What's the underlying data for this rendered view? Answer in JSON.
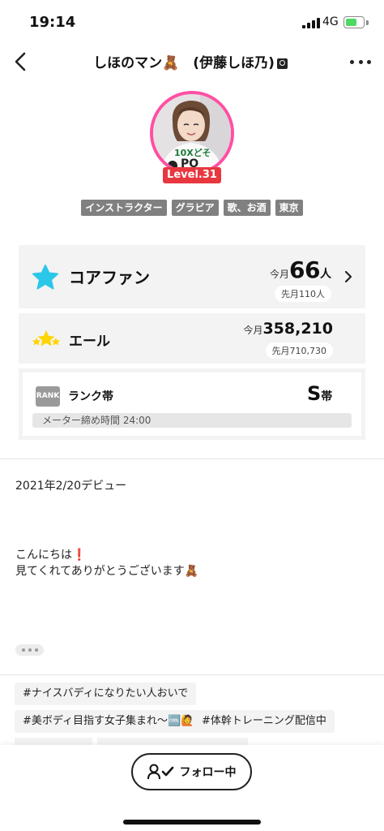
{
  "status_bar": {
    "time": "19:14",
    "network": "4G"
  },
  "header": {
    "title": "しほのマン🧸　(伊藤しほ乃)",
    "back_icon": "chevron-left-icon",
    "more_icon": "more-horizontal-icon"
  },
  "profile": {
    "level": "Level.31",
    "tags": [
      "インストラクター",
      "グラビア",
      "歌、お酒",
      "東京"
    ],
    "colors": {
      "avatar_ring": "#ff4fa3",
      "level_badge": "#e8373f"
    }
  },
  "core_fan": {
    "label": "コアファン",
    "this_month_label": "今月",
    "count": "66",
    "unit": "人",
    "last_month": "先月110人",
    "icon_color": "#2bc7e8"
  },
  "yell": {
    "label": "エール",
    "this_month_label": "今月",
    "value": "358,210",
    "last_month": "先月710,730",
    "icon_color": "#ffd400"
  },
  "rank": {
    "badge": "RANK",
    "label": "ランク帯",
    "grade": "S",
    "grade_suffix": "帯",
    "meter_note": "メーター締め時間 24:00"
  },
  "bio": {
    "debut": "2021年2/20デビュー",
    "line1": "こんにちは",
    "line1_emoji": "❗",
    "line2": "見てくれてありがとうございます🧸"
  },
  "hashtags": [
    "#ナイスバディになりたい人おいで",
    "#美ボディ目指す女子集まれ〜🆒🙋",
    "#体幹トレーニング配信中"
  ],
  "follow_button": {
    "label": "フォロー中"
  }
}
